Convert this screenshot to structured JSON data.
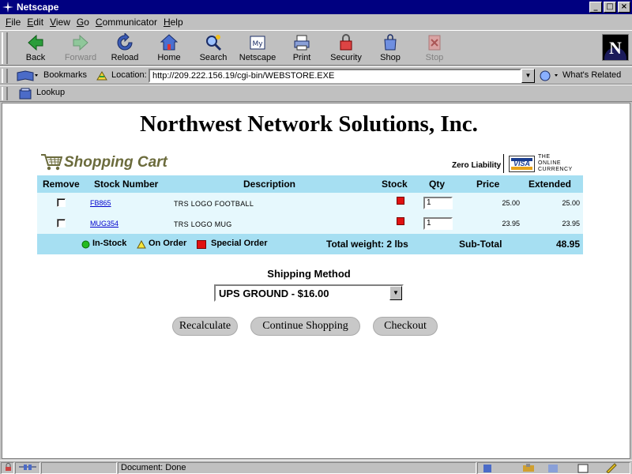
{
  "window": {
    "title": "Netscape",
    "min": "_",
    "max": "□",
    "close": "×"
  },
  "menu": [
    {
      "u": "F",
      "rest": "ile"
    },
    {
      "u": "E",
      "rest": "dit"
    },
    {
      "u": "V",
      "rest": "iew"
    },
    {
      "u": "G",
      "rest": "o"
    },
    {
      "u": "C",
      "rest": "ommunicator"
    },
    {
      "u": "H",
      "rest": "elp"
    }
  ],
  "toolbar": {
    "back": "Back",
    "forward": "Forward",
    "reload": "Reload",
    "home": "Home",
    "search": "Search",
    "netscape": "Netscape",
    "print": "Print",
    "security": "Security",
    "shop": "Shop",
    "stop": "Stop"
  },
  "locbar": {
    "bookmarks": "Bookmarks",
    "location_label": "Location:",
    "url": "http://209.222.156.19/cgi-bin/WEBSTORE.EXE",
    "whats_related": "What's Related"
  },
  "personal": {
    "lookup": "Lookup"
  },
  "page": {
    "company": "Northwest Network Solutions, Inc.",
    "cart_title": "Shopping Cart",
    "zero_liability": "Zero Liability",
    "visa": "VISA",
    "online_currency": [
      "THE",
      "ONLINE",
      "CURRENCY"
    ],
    "headers": {
      "remove": "Remove",
      "stock_number": "Stock Number",
      "description": "Description",
      "stock": "Stock",
      "qty": "Qty",
      "price": "Price",
      "extended": "Extended"
    },
    "items": [
      {
        "sku": "FB865",
        "description": "TRS LOGO FOOTBALL",
        "qty": "1",
        "price": "25.00",
        "extended": "25.00"
      },
      {
        "sku": "MUG354",
        "description": "TRS LOGO MUG",
        "qty": "1",
        "price": "23.95",
        "extended": "23.95"
      }
    ],
    "legend": {
      "in_stock": "In-Stock",
      "on_order": "On Order",
      "special_order": "Special Order"
    },
    "total_weight": "Total weight: 2 lbs",
    "subtotal_label": "Sub-Total",
    "subtotal_value": "48.95",
    "shipping_label": "Shipping Method",
    "shipping_value": "UPS GROUND - $16.00",
    "buttons": {
      "recalculate": "Recalculate",
      "continue": "Continue Shopping",
      "checkout": "Checkout"
    }
  },
  "status": {
    "text": "Document: Done"
  },
  "colors": {
    "header_bg": "#a6dff2",
    "row_bg": "#e6f8fd",
    "title_bar": "#000080",
    "stock_red": "#e01010"
  }
}
